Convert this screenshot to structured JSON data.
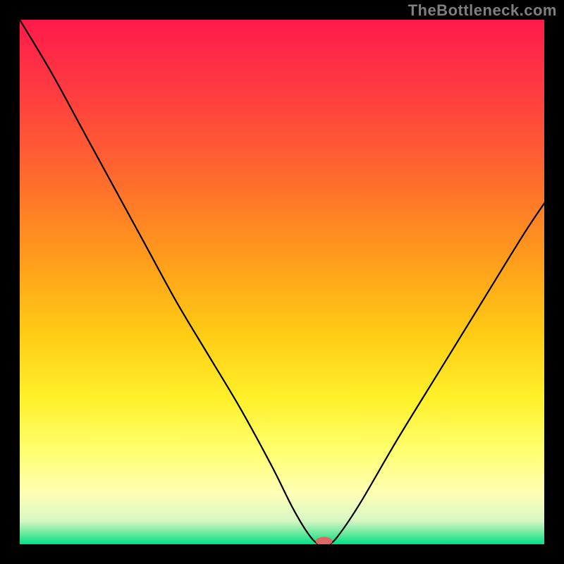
{
  "watermark": "TheBottleneck.com",
  "chart_data": {
    "type": "line",
    "title": "",
    "xlabel": "",
    "ylabel": "",
    "xlim": [
      0,
      100
    ],
    "ylim": [
      0,
      100
    ],
    "legend": null,
    "grid": false,
    "gradient_stops": [
      {
        "offset": 0.0,
        "color": "#ff1a4b"
      },
      {
        "offset": 0.15,
        "color": "#ff3f3f"
      },
      {
        "offset": 0.3,
        "color": "#ff6a2d"
      },
      {
        "offset": 0.45,
        "color": "#ff9a1c"
      },
      {
        "offset": 0.6,
        "color": "#ffcc14"
      },
      {
        "offset": 0.72,
        "color": "#fff029"
      },
      {
        "offset": 0.82,
        "color": "#ffff6e"
      },
      {
        "offset": 0.9,
        "color": "#ffffb4"
      },
      {
        "offset": 0.955,
        "color": "#d8f7c4"
      },
      {
        "offset": 0.985,
        "color": "#4de695"
      },
      {
        "offset": 1.0,
        "color": "#00e18a"
      }
    ],
    "series": [
      {
        "name": "bottleneck-curve",
        "x": [
          0,
          6,
          12,
          18,
          24,
          30,
          36,
          42,
          48,
          52,
          55,
          57,
          59,
          61,
          65,
          72,
          80,
          88,
          96,
          100
        ],
        "y": [
          100,
          90,
          79,
          68,
          57,
          46,
          36,
          26,
          15,
          7,
          2,
          0,
          0,
          2,
          8,
          20,
          33,
          46,
          59,
          65
        ]
      }
    ],
    "marker": {
      "name": "optimal-point",
      "x": 58,
      "y": 0.6,
      "color": "#e06666",
      "rx": 12,
      "ry": 6
    }
  }
}
